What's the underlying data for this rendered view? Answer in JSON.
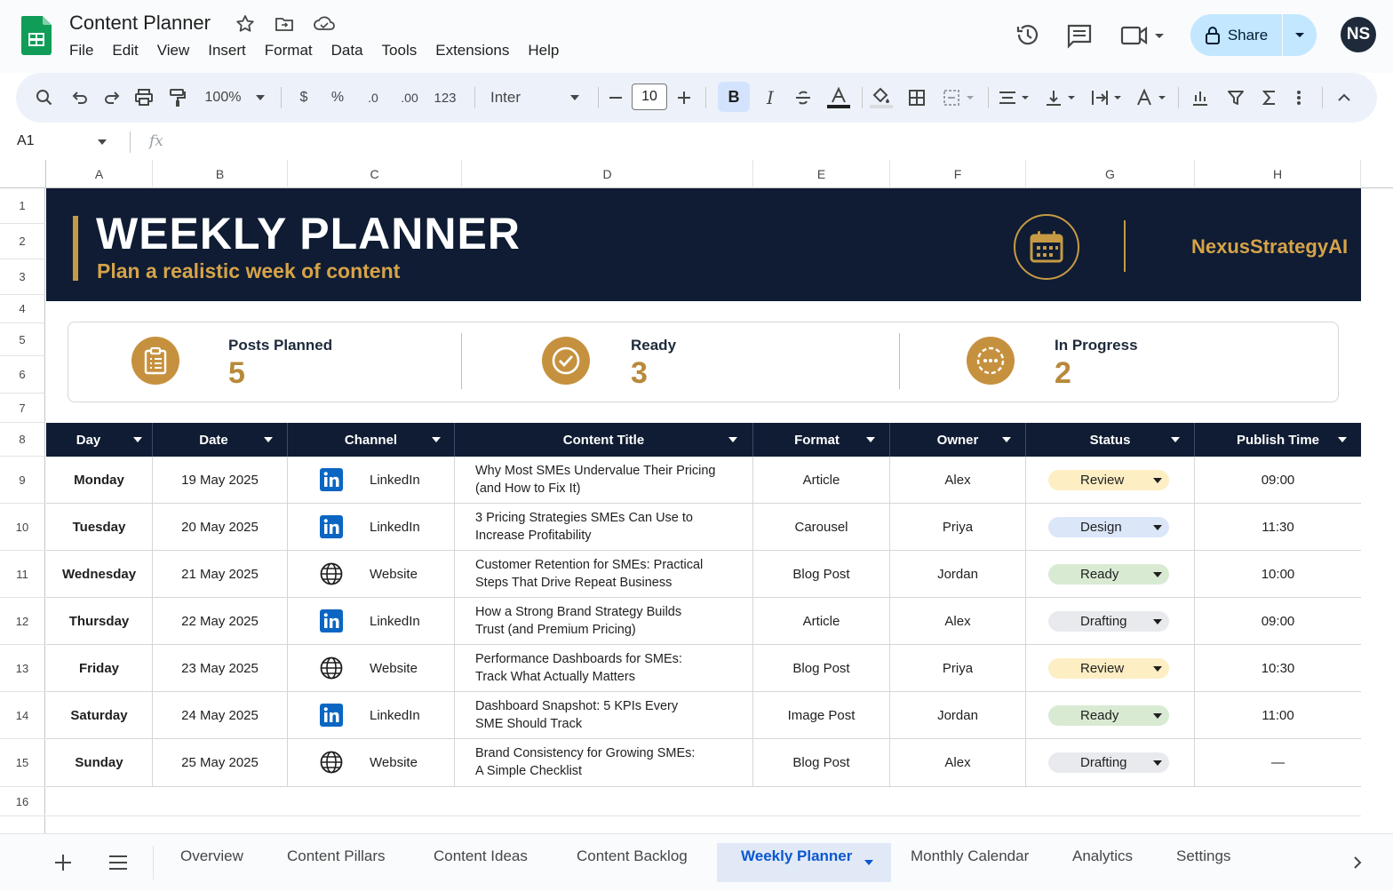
{
  "app": {
    "doc_title": "Content Planner",
    "menu": [
      "File",
      "Edit",
      "View",
      "Insert",
      "Format",
      "Data",
      "Tools",
      "Extensions",
      "Help"
    ],
    "share_label": "Share",
    "avatar_initials": "NS"
  },
  "toolbar": {
    "zoom": "100%",
    "currency": "$",
    "percent": "%",
    "dec_minus": ".0",
    "dec_plus": ".00",
    "number_format": "123",
    "font": "Inter",
    "font_size": "10",
    "bold": "B",
    "italic": "I"
  },
  "formula_bar": {
    "cell_ref": "A1",
    "fx": "fx"
  },
  "columns": [
    "A",
    "B",
    "C",
    "D",
    "E",
    "F",
    "G",
    "H"
  ],
  "rows": [
    "1",
    "2",
    "3",
    "4",
    "5",
    "6",
    "7",
    "8",
    "9",
    "10",
    "11",
    "12",
    "13",
    "14",
    "15",
    "16"
  ],
  "banner": {
    "title": "WEEKLY PLANNER",
    "subtitle": "Plan a realistic week of content",
    "brand": "NexusStrategyAI",
    "icon": "calendar-icon"
  },
  "kpis": [
    {
      "label": "Posts Planned",
      "value": "5",
      "icon": "clipboard-icon"
    },
    {
      "label": "Ready",
      "value": "3",
      "icon": "check-circle-icon"
    },
    {
      "label": "In Progress",
      "value": "2",
      "icon": "dots-circle-icon"
    }
  ],
  "table": {
    "headers": [
      "Day",
      "Date",
      "Channel",
      "Content Title",
      "Format",
      "Owner",
      "Status",
      "Publish Time"
    ],
    "rows": [
      {
        "day": "Monday",
        "date": "19 May 2025",
        "channel": "LinkedIn",
        "title": [
          "Why Most SMEs Undervalue Their Pricing",
          "(and How to Fix It)"
        ],
        "format": "Article",
        "owner": "Alex",
        "status": "Review",
        "time": "09:00"
      },
      {
        "day": "Tuesday",
        "date": "20 May 2025",
        "channel": "LinkedIn",
        "title": [
          "3 Pricing Strategies SMEs Can Use to",
          "Increase Profitability"
        ],
        "format": "Carousel",
        "owner": "Priya",
        "status": "Design",
        "time": "11:30"
      },
      {
        "day": "Wednesday",
        "date": "21 May 2025",
        "channel": "Website",
        "title": [
          "Customer Retention for SMEs: Practical",
          "Steps That Drive Repeat Business"
        ],
        "format": "Blog Post",
        "owner": "Jordan",
        "status": "Ready",
        "time": "10:00"
      },
      {
        "day": "Thursday",
        "date": "22 May 2025",
        "channel": "LinkedIn",
        "title": [
          "How a Strong Brand Strategy Builds",
          "Trust (and Premium Pricing)"
        ],
        "format": "Article",
        "owner": "Alex",
        "status": "Drafting",
        "time": "09:00"
      },
      {
        "day": "Friday",
        "date": "23 May 2025",
        "channel": "Website",
        "title": [
          "Performance Dashboards for SMEs:",
          "Track What Actually Matters"
        ],
        "format": "Blog Post",
        "owner": "Priya",
        "status": "Review",
        "time": "10:30"
      },
      {
        "day": "Saturday",
        "date": "24 May 2025",
        "channel": "LinkedIn",
        "title": [
          "Dashboard Snapshot: 5 KPIs Every",
          "SME Should Track"
        ],
        "format": "Image Post",
        "owner": "Jordan",
        "status": "Ready",
        "time": "11:00"
      },
      {
        "day": "Sunday",
        "date": "25 May 2025",
        "channel": "Website",
        "title": [
          "Brand Consistency for Growing SMEs:",
          "A Simple Checklist"
        ],
        "format": "Blog Post",
        "owner": "Alex",
        "status": "Drafting",
        "time": "—"
      }
    ]
  },
  "status_colors": {
    "Review": "#fdeec4",
    "Design": "#dbe7f9",
    "Ready": "#d9ead3",
    "Drafting": "#e8eaed"
  },
  "colors": {
    "banner_bg": "#0f1c33",
    "gold": "#c69a45",
    "share_bg": "#c2e7ff"
  },
  "tabs": [
    "Overview",
    "Content Pillars",
    "Content Ideas",
    "Content Backlog",
    "Weekly Planner",
    "Monthly Calendar",
    "Analytics",
    "Settings"
  ],
  "active_tab": "Weekly Planner"
}
